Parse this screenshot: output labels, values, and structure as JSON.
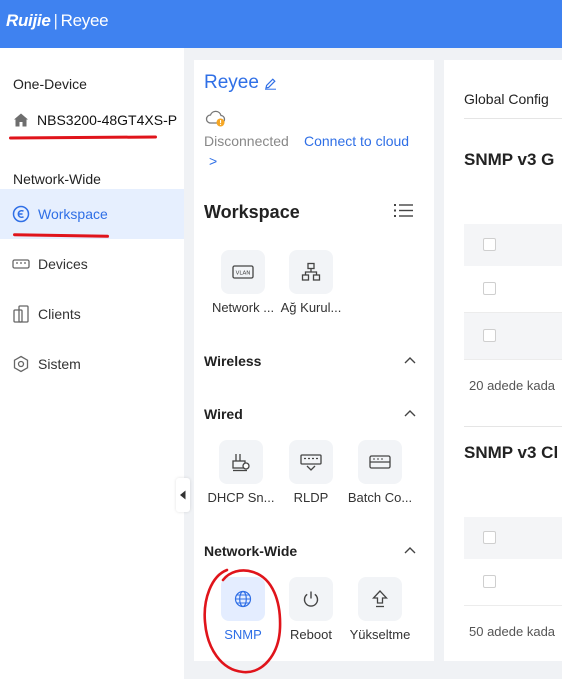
{
  "header": {
    "logo_brand": "Ruijie",
    "logo_sep": "|",
    "logo_sub": "Reyee",
    "bg_color": "#3f82f0"
  },
  "sidebar": {
    "one_device_heading": "One-Device",
    "device_name": "NBS3200-48GT4XS-P",
    "network_wide_heading": "Network-Wide",
    "items": [
      {
        "label": "Workspace",
        "icon": "workspace-icon",
        "active": true
      },
      {
        "label": "Devices",
        "icon": "devices-icon",
        "active": false
      },
      {
        "label": "Clients",
        "icon": "clients-icon",
        "active": false
      },
      {
        "label": "Sistem",
        "icon": "system-icon",
        "active": false
      }
    ]
  },
  "middle": {
    "site_name": "Reyee",
    "cloud_status": "Disconnected",
    "connect_link": "Connect to cloud",
    "connect_chevron": ">",
    "workspace_title": "Workspace",
    "top_tiles": [
      {
        "label": "Network ...",
        "icon": "vlan-icon"
      },
      {
        "label": "Ağ Kurul...",
        "icon": "topology-icon"
      }
    ],
    "sections": {
      "wireless": "Wireless",
      "wired": "Wired",
      "network_wide": "Network-Wide"
    },
    "wired_tiles": [
      {
        "label": "DHCP Sn...",
        "icon": "dhcp-snooping-icon"
      },
      {
        "label": "RLDP",
        "icon": "rldp-icon"
      },
      {
        "label": "Batch Co...",
        "icon": "batch-config-icon"
      }
    ],
    "network_wide_tiles": [
      {
        "label": "SNMP",
        "icon": "globe-icon",
        "selected": true
      },
      {
        "label": "Reboot",
        "icon": "power-icon",
        "selected": false
      },
      {
        "label": "Yükseltme",
        "icon": "upgrade-icon",
        "selected": false
      }
    ]
  },
  "right": {
    "tab_label": "Global Config",
    "snmp_v3_group_title": "SNMP v3 G",
    "snmp_v3_client_title": "SNMP v3 Cl",
    "footer_1": "20 adede kada",
    "footer_2": "50 adede kada"
  },
  "colors": {
    "accent": "#2f6fe6",
    "active_bg": "#e6effe",
    "annotation_red": "#e0141b"
  }
}
